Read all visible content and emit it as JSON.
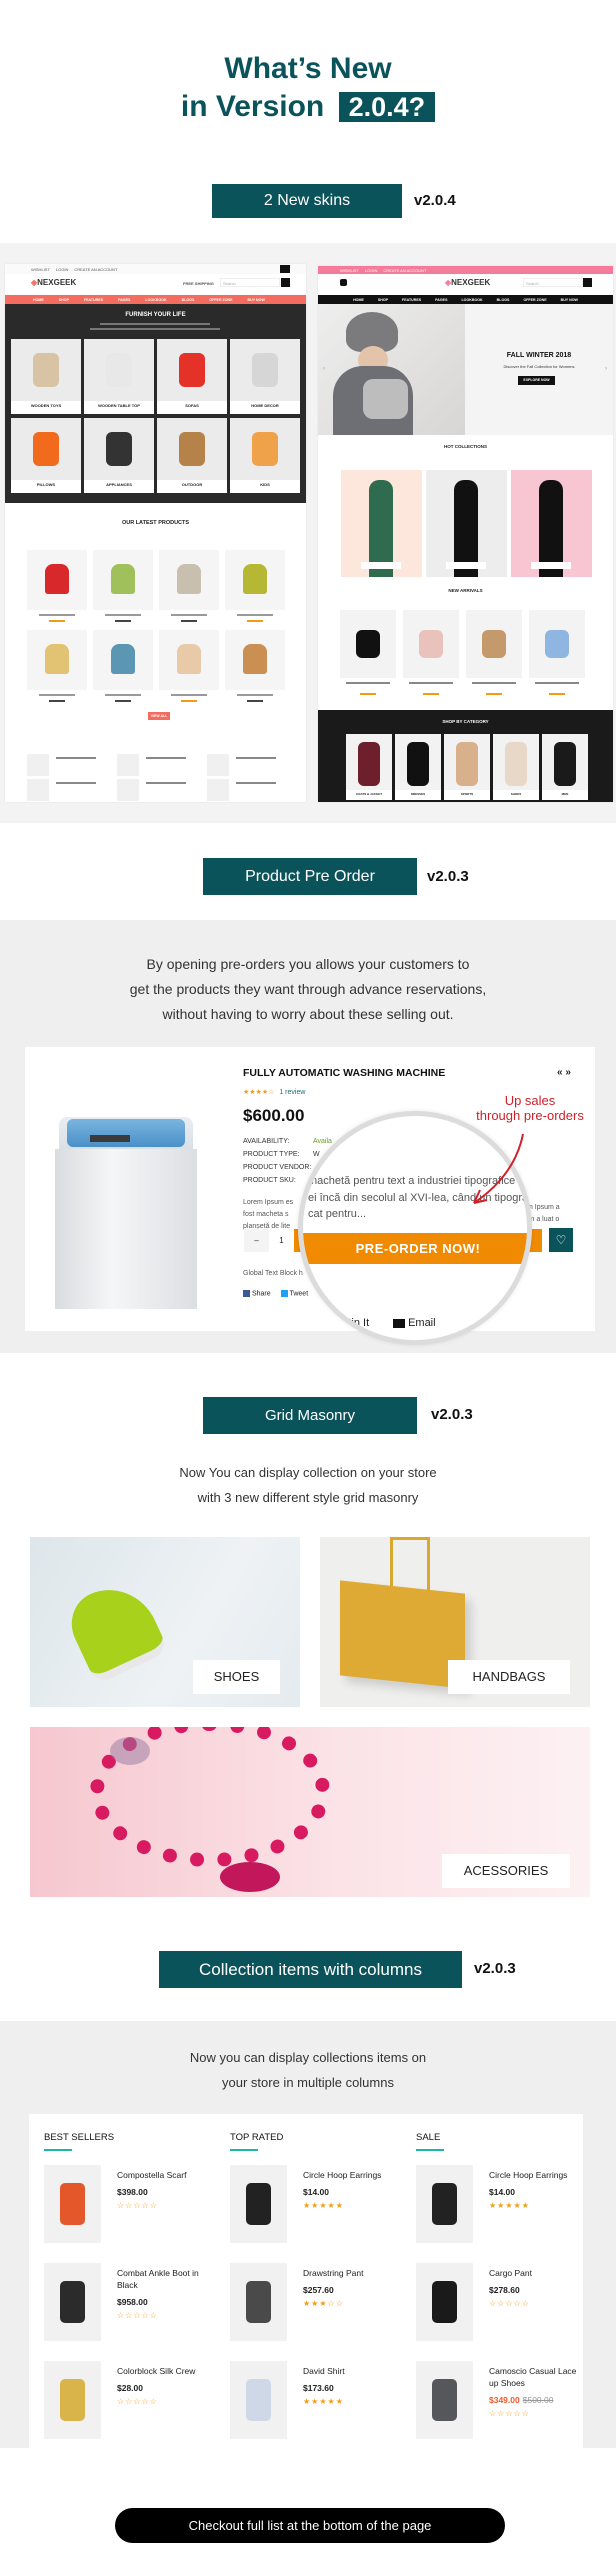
{
  "header": {
    "title_line1": "What’s New",
    "title_line2": "in Version",
    "version_badge": "2.0.4?"
  },
  "skins": {
    "label": "2 New skins",
    "version": "v2.0.4",
    "left": {
      "top_links": [
        "WISHLIST",
        "LOGIN",
        "CREATE AN ACCOUNT"
      ],
      "logo": "NEXGEEK",
      "shipping": "FREE SHIPPING",
      "search_placeholder": "Search",
      "nav": [
        "HOME",
        "SHOP",
        "FEATURES",
        "PAGES",
        "LOOKBOOK",
        "BLOGS",
        "OFFER ZONE",
        "BUY NOW"
      ],
      "hero_title": "FURNISH YOUR LIFE",
      "categories": [
        "WOODEN TOYS",
        "WOODEN TABLE TOP",
        "SOFAS",
        "HOME DECOR",
        "PILLOWS",
        "APPLIANCES",
        "OUTDOOR",
        "KIDS"
      ],
      "latest_title": "OUR LATEST PRODUCTS",
      "view_all": "VIEW ALL"
    },
    "right": {
      "top_links": [
        "WISHLIST",
        "LOGIN",
        "CREATE AN ACCOUNT"
      ],
      "logo": "NEXGEEK",
      "search_placeholder": "Search",
      "nav": [
        "HOME",
        "SHOP",
        "FEATURES",
        "PAGES",
        "LOOKBOOK",
        "BLOGS",
        "OFFER ZONE",
        "BUY NOW"
      ],
      "hero_title": "FALL WINTER 2018",
      "hero_subtitle": "Discover the Fall Collection for Womens",
      "hero_button": "EXPLORE NOW",
      "hot_title": "HOT COLLECTIONS",
      "new_title": "NEW ARRIVALS",
      "shop_title": "SHOP BY CATEGORY",
      "categories": [
        "COATS & JACKET",
        "DRESSES",
        "SPORTS",
        "SHOES",
        "MEN"
      ]
    },
    "colors": {
      "left_accent": "#f46b5f",
      "right_accent": "#f47c9a"
    }
  },
  "preorder": {
    "label": "Product Pre Order",
    "version": "v2.0.3",
    "description": [
      "By opening pre-orders  you allows  your customers to",
      "get the products they want through advance reservations,",
      "without having to worry about these selling out."
    ],
    "product": {
      "title": "FULLY AUTOMATIC WASHING MACHINE",
      "rating": 4,
      "reviews": "1 review",
      "price": "$600.00",
      "details": [
        {
          "label": "AVAILABILITY:",
          "value": "Availa"
        },
        {
          "label": "PRODUCT TYPE:",
          "value": "W"
        },
        {
          "label": "PRODUCT VENDOR:",
          "value": ""
        },
        {
          "label": "PRODUCT SKU:",
          "value": ""
        }
      ],
      "desc_left": [
        "Lorem Ipsum es",
        "fost macheta s",
        "planșetă de lite"
      ],
      "desc_right": [
        "m Ipsum a",
        "im a luat o"
      ],
      "quantity": "1",
      "global_text": "Global Text Block h",
      "share": "Share",
      "tweet": "Tweet",
      "pin": "Pin It",
      "email": "Email"
    },
    "magnifier": {
      "lines": [
        "machetă pentru text a industriei tipografice",
        "ei încă din secolul al XVI-lea, când un tipograf",
        "cat pentru..."
      ],
      "button": "PRE-ORDER NOW!"
    },
    "callout": [
      "Up sales",
      "through pre-orders"
    ],
    "colors": {
      "button": "#f08a00",
      "callout": "#d0202a",
      "wishlist": "#0b535a"
    }
  },
  "masonry": {
    "label": "Grid Masonry",
    "version": "v2.0.3",
    "description": [
      "Now You can display collection on your store",
      "with 3 new different style grid masonry"
    ],
    "tiles": [
      "SHOES",
      "HANDBAGS",
      "ACESSORIES"
    ]
  },
  "collections": {
    "label": "Collection items with columns",
    "version": "v2.0.3",
    "description": [
      "Now you can display collections items on",
      "your store in multiple columns"
    ],
    "columns": [
      {
        "title": "BEST SELLERS",
        "items": [
          {
            "name": "Compostella Scarf",
            "price": "$398.00",
            "rating": 0
          },
          {
            "name": "Combat Ankle Boot in Black",
            "price": "$958.00",
            "rating": 0
          },
          {
            "name": "Colorblock Silk Crew",
            "price": "$28.00",
            "rating": 0
          }
        ]
      },
      {
        "title": "TOP RATED",
        "items": [
          {
            "name": "Circle Hoop Earrings",
            "price": "$14.00",
            "rating": 5
          },
          {
            "name": "Drawstring Pant",
            "price": "$257.60",
            "rating": 3
          },
          {
            "name": "David Shirt",
            "price": "$173.60",
            "rating": 5
          }
        ]
      },
      {
        "title": "SALE",
        "items": [
          {
            "name": "Circle Hoop Earrings",
            "price": "$14.00",
            "rating": 5
          },
          {
            "name": "Cargo Pant",
            "price": "$278.60",
            "rating": 0
          },
          {
            "name": "Camoscio Casual Lace up Shoes",
            "price": "$349.00",
            "old_price": "$500.00",
            "rating": 0
          }
        ]
      }
    ]
  },
  "cta": {
    "label": "Checkout full list at the bottom of the page"
  },
  "theme": {
    "primary": "#0b535a",
    "star": "#f39c12",
    "underline": "#1fb5a8"
  }
}
